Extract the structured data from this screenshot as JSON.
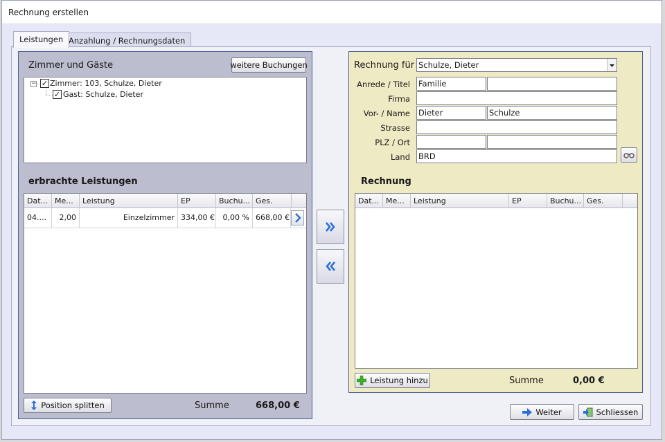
{
  "window": {
    "title": "Rechnung erstellen"
  },
  "tabs": [
    {
      "label": "Leistungen",
      "active": true
    },
    {
      "label": "Anzahlung / Rechnungsdaten",
      "active": false
    }
  ],
  "left": {
    "rooms_heading": "Zimmer und Gäste",
    "more_bookings_label": "weitere Buchungen",
    "tree": {
      "room_label": "Zimmer: 103, Schulze, Dieter",
      "guest_label": "Gast: Schulze, Dieter"
    },
    "services_heading": "erbrachte Leistungen",
    "columns": [
      "Dat...",
      "Me...",
      "Leistung",
      "EP",
      "Buchu...",
      "Ges."
    ],
    "rows": [
      {
        "date": "04....",
        "qty": "2,00",
        "service": "Einzelzimmer",
        "ep": "334,00 €",
        "booking": "0,00 %",
        "total": "668,00 €"
      }
    ],
    "split_label": "Position splitten",
    "sum_label": "Summe",
    "sum_value": "668,00 €"
  },
  "right": {
    "invoice_for_label": "Rechnung für",
    "invoice_for_value": "Schulze, Dieter",
    "form": {
      "salutation_label": "Anrede / Titel",
      "salutation_value": "Familie",
      "title_value": "",
      "company_label": "Firma",
      "company_value": "",
      "name_label": "Vor- / Name",
      "first_name_value": "Dieter",
      "last_name_value": "Schulze",
      "street_label": "Strasse",
      "street_value": "",
      "zip_city_label": "PLZ / Ort",
      "zip_value": "",
      "city_value": "",
      "country_label": "Land",
      "country_value": "BRD"
    },
    "invoice_heading": "Rechnung",
    "columns": [
      "Dat...",
      "Me...",
      "Leistung",
      "EP",
      "Buchu...",
      "Ges."
    ],
    "add_service_label": "Leistung hinzu",
    "sum_label": "Summe",
    "sum_value": "0,00 €"
  },
  "footer": {
    "next_label": "Weiter",
    "close_label": "Schliessen"
  },
  "colors": {
    "left_panel_bg": "#bcbdcf",
    "right_panel_bg": "#eeeac4",
    "panel_border": "#4b5f95",
    "arrow_blue": "#2b6fd8"
  }
}
